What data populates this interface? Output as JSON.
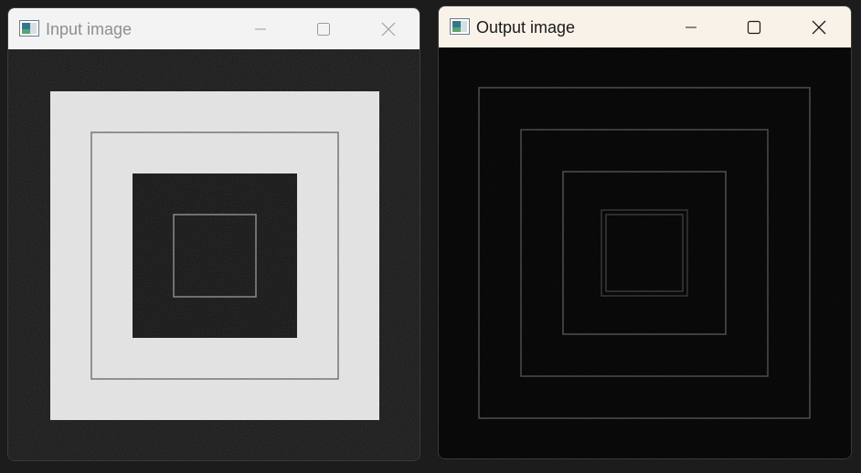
{
  "windows": {
    "input": {
      "title": "Input image",
      "state": "inactive",
      "icon": "image-app-icon",
      "controls": [
        "minimize-icon",
        "maximize-icon",
        "close-icon"
      ]
    },
    "output": {
      "title": "Output image",
      "state": "active",
      "icon": "image-app-icon",
      "controls": [
        "minimize-icon",
        "maximize-icon",
        "close-icon"
      ]
    }
  },
  "colors": {
    "desktop": "#1c1c1c",
    "inactive_titlebar": "#f3f3f3",
    "active_titlebar": "#f9f2e8",
    "input_background": "#161616",
    "input_light_band": "#e6e6e6",
    "input_dark_square": "#121212",
    "output_background": "#040404",
    "output_edge_line": "#4a4a4a"
  }
}
